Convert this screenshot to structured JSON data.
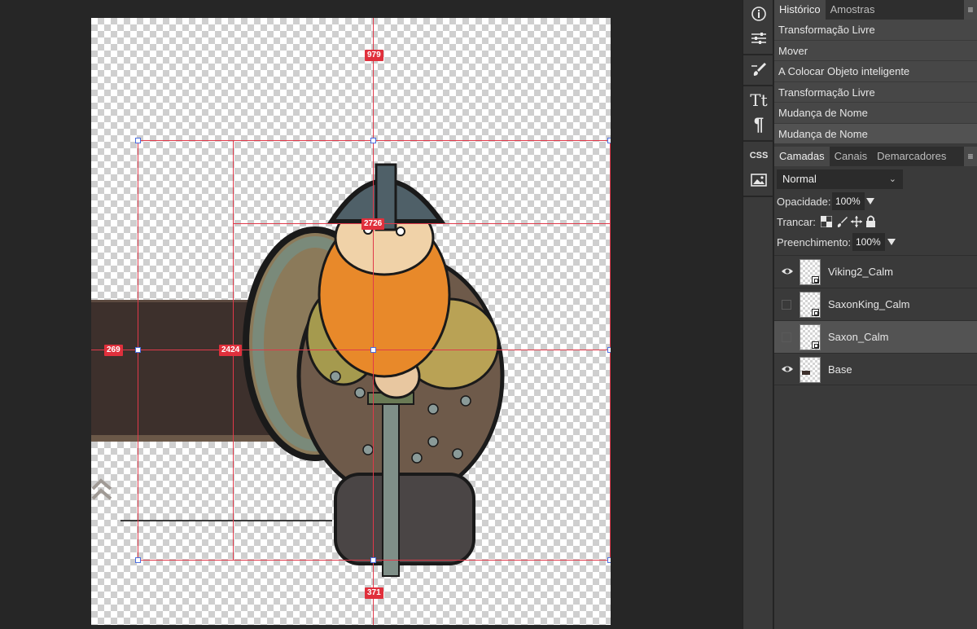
{
  "history_panel": {
    "tabs": [
      "Histórico",
      "Amostras"
    ],
    "active_tab": "Histórico",
    "items": [
      "Transformação Livre",
      "Mover",
      "A Colocar Objeto inteligente",
      "Transformação Livre",
      "Mudança de Nome",
      "Mudança de Nome"
    ]
  },
  "layers_panel": {
    "tabs": [
      "Camadas",
      "Canais",
      "Demarcadores"
    ],
    "active_tab": "Camadas",
    "blend_mode": "Normal",
    "opacity_label": "Opacidade:",
    "opacity_value": "100%",
    "lock_label": "Trancar:",
    "fill_label": "Preenchimento:",
    "fill_value": "100%",
    "layers": [
      {
        "name": "Viking2_Calm",
        "visible": true,
        "smart_object": true,
        "selected": false
      },
      {
        "name": "SaxonKing_Calm",
        "visible": false,
        "smart_object": true,
        "selected": false
      },
      {
        "name": "Saxon_Calm",
        "visible": false,
        "smart_object": true,
        "selected": true
      },
      {
        "name": "Base",
        "visible": true,
        "smart_object": false,
        "selected": false
      }
    ]
  },
  "measurements": {
    "top": "979",
    "inner_top": "2726",
    "left": "269",
    "inner_left": "2424",
    "bottom": "371"
  },
  "toolstrip": {
    "icons": [
      "info-icon",
      "adjustments-icon",
      "brush-settings-icon",
      "character-icon",
      "paragraph-icon",
      "css-icon",
      "image-icon"
    ],
    "css_label": "CSS",
    "char_label": "Tt",
    "para_label": "¶",
    "info_label": "ⓘ"
  },
  "colors": {
    "guide": "#e0394a",
    "panel_bg": "#3a3a3a",
    "workspace_bg": "#262626"
  }
}
